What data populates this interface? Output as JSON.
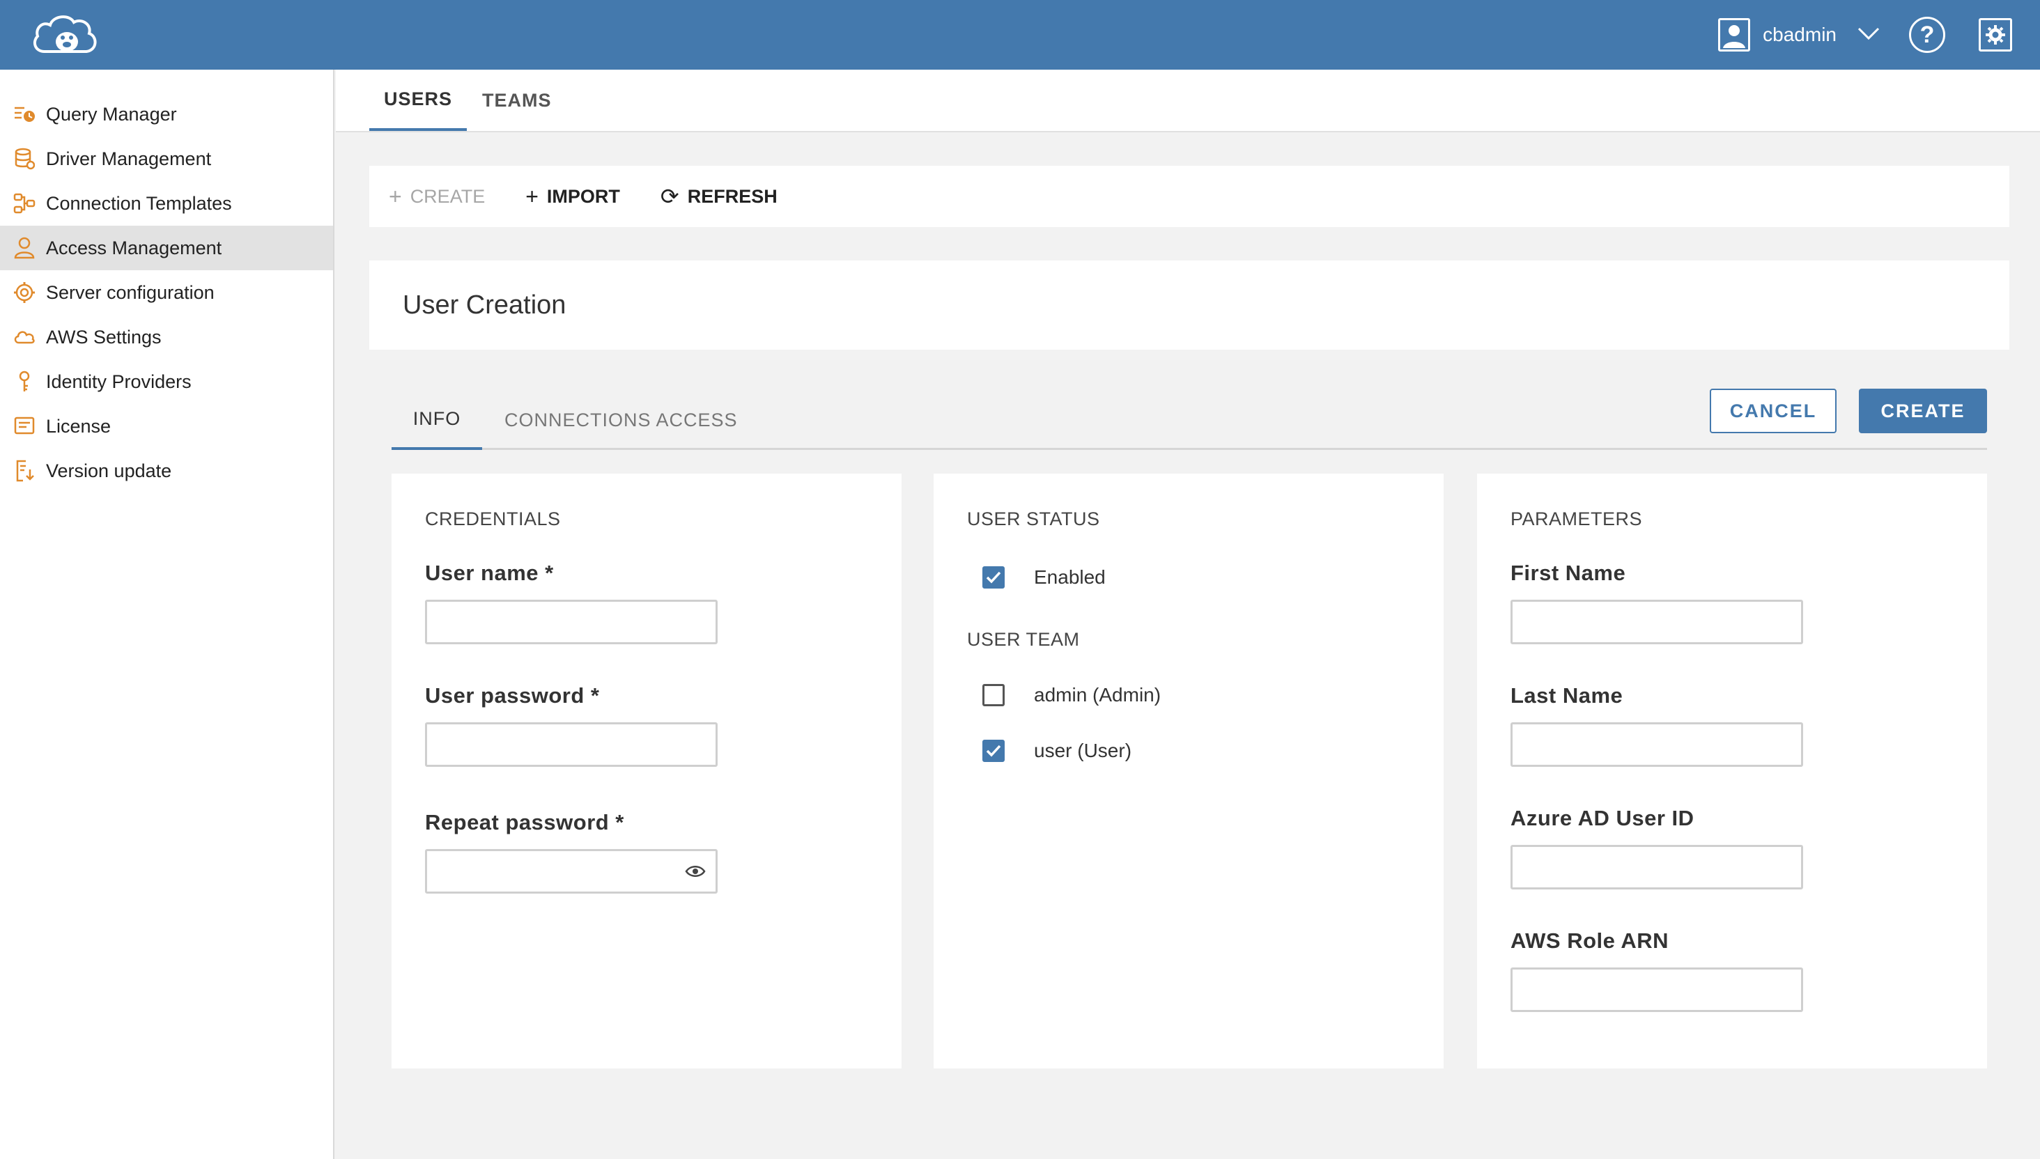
{
  "header": {
    "username": "cbadmin"
  },
  "sidebar": {
    "items": [
      {
        "label": "Query Manager",
        "icon": "query-manager-icon"
      },
      {
        "label": "Driver Management",
        "icon": "database-icon"
      },
      {
        "label": "Connection Templates",
        "icon": "connection-icon"
      },
      {
        "label": "Access Management",
        "icon": "person-icon",
        "active": true
      },
      {
        "label": "Server configuration",
        "icon": "gear-icon"
      },
      {
        "label": "AWS Settings",
        "icon": "cloud-icon"
      },
      {
        "label": "Identity Providers",
        "icon": "key-icon"
      },
      {
        "label": "License",
        "icon": "license-icon"
      },
      {
        "label": "Version update",
        "icon": "version-update-icon"
      }
    ]
  },
  "main_tabs": [
    {
      "label": "USERS",
      "active": true
    },
    {
      "label": "TEAMS"
    }
  ],
  "toolbar": {
    "create_label": "CREATE",
    "import_label": "IMPORT",
    "refresh_label": "REFRESH"
  },
  "page_title": "User Creation",
  "sub_tabs": [
    {
      "label": "INFO",
      "active": true
    },
    {
      "label": "CONNECTIONS ACCESS"
    }
  ],
  "actions": {
    "cancel_label": "CANCEL",
    "create_label": "CREATE"
  },
  "credentials": {
    "title": "CREDENTIALS",
    "user_name_label": "User name *",
    "user_password_label": "User password *",
    "repeat_password_label": "Repeat password *"
  },
  "user_status": {
    "title": "USER STATUS",
    "enabled_label": "Enabled",
    "enabled_checked": true,
    "team_title": "USER TEAM",
    "teams": [
      {
        "label": "admin (Admin)",
        "checked": false
      },
      {
        "label": "user (User)",
        "checked": true
      }
    ]
  },
  "parameters": {
    "title": "PARAMETERS",
    "first_name_label": "First Name",
    "last_name_label": "Last Name",
    "azure_label": "Azure AD User ID",
    "aws_role_label": "AWS Role ARN"
  },
  "colors": {
    "primary": "#4479ad",
    "icon_orange": "#e08a2c"
  }
}
